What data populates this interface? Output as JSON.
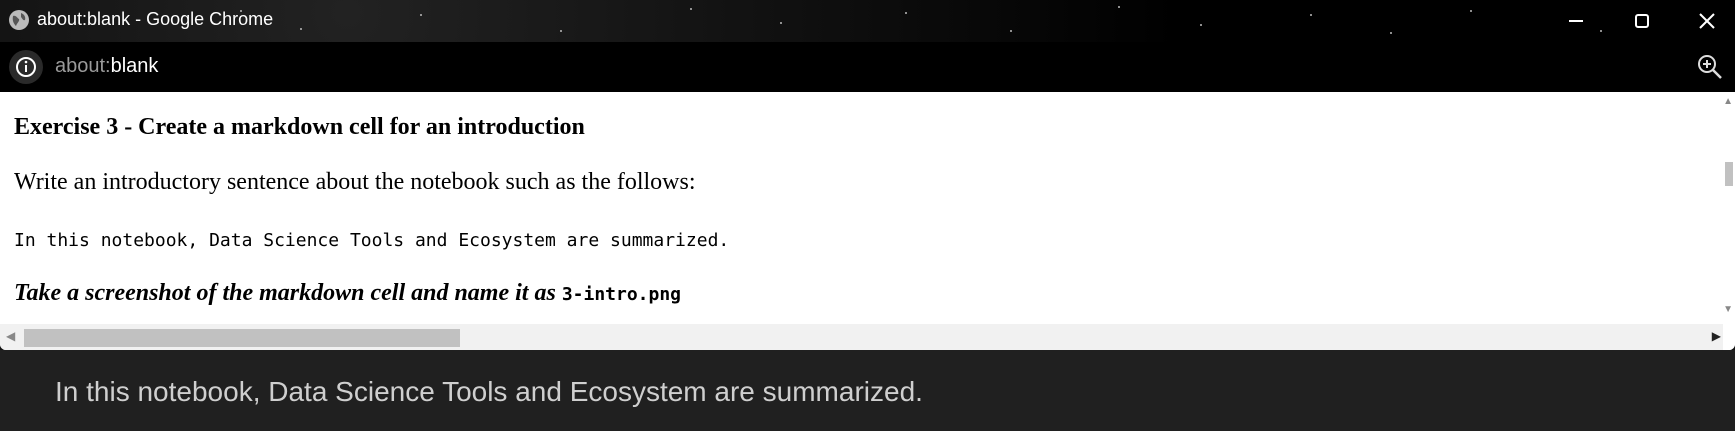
{
  "window": {
    "title": "about:blank - Google Chrome"
  },
  "toolbar": {
    "url_scheme": "about:",
    "url_path": "blank"
  },
  "page": {
    "heading": "Exercise 3 - Create a markdown cell for an introduction",
    "paragraph": "Write an introductory sentence about the notebook such as the follows:",
    "code_line": "In this notebook, Data Science Tools and Ecosystem are summarized.",
    "instruction_prefix": "Take a screenshot of the markdown cell and name it as ",
    "instruction_filename": "3-intro.png"
  },
  "caption": {
    "text": "In this notebook, Data Science Tools and Ecosystem are summarized."
  },
  "icons": {
    "app": "globe-icon",
    "info": "info-icon",
    "zoom": "zoom-in-icon",
    "minimize": "minimize-icon",
    "maximize": "maximize-icon",
    "close": "close-icon"
  }
}
